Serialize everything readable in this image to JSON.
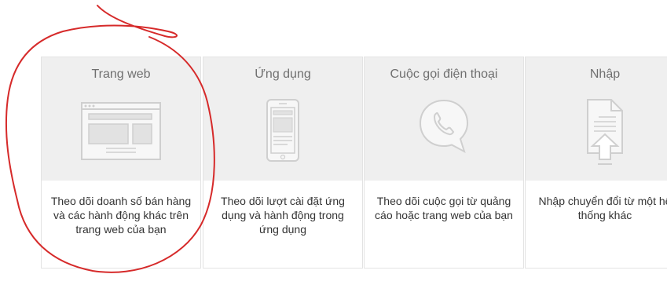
{
  "cards": [
    {
      "title": "Trang web",
      "description": "Theo dõi doanh số bán hàng và các hành động khác trên trang web của bạn",
      "icon": "webpage-icon"
    },
    {
      "title": "Ứng dụng",
      "description": "Theo dõi lượt cài đặt ứng dụng và hành động trong ứng dụng",
      "icon": "mobile-app-icon"
    },
    {
      "title": "Cuộc gọi điện thoại",
      "description": "Theo dõi cuộc gọi từ quảng cáo hoặc trang web của bạn",
      "icon": "phone-call-icon"
    },
    {
      "title": "Nhập",
      "description": "Nhập chuyển đổi từ một hệ thống khác",
      "icon": "import-file-icon"
    }
  ],
  "colors": {
    "card_top_bg": "#efefef",
    "card_border": "#e3e3e3",
    "icon_stroke": "#cfcfcf",
    "annotation": "#d62a2a"
  }
}
